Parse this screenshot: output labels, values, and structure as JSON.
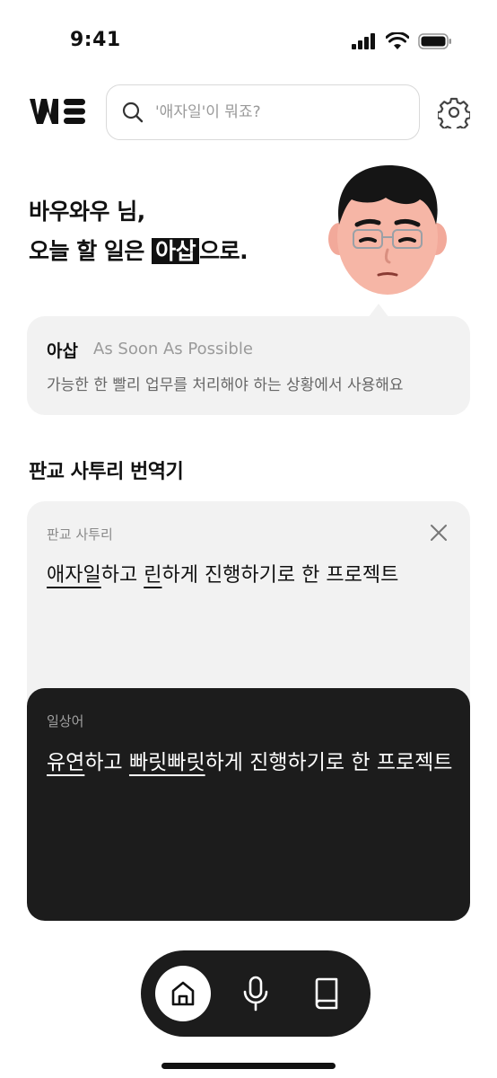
{
  "status_bar": {
    "time": "9:41"
  },
  "search": {
    "placeholder": "'애자일'이 뭐죠?"
  },
  "greeting": {
    "line1": "바우와우 님,",
    "line2_prefix": "오늘 할 일은 ",
    "line2_highlight": "아삽",
    "line2_suffix": "으로."
  },
  "definition": {
    "word": "아삽",
    "full": "As Soon As Possible",
    "description": "가능한 한 빨리 업무를 처리해야 하는 상황에서 사용해요"
  },
  "translator": {
    "title": "판교 사투리 번역기",
    "input_label": "판교 사투리",
    "input_parts": [
      {
        "text": "애자일",
        "underline": true
      },
      {
        "text": "하고 ",
        "underline": false
      },
      {
        "text": "린",
        "underline": true
      },
      {
        "text": "하게 진행하기로 한 프로젝트",
        "underline": false
      }
    ],
    "output_label": "일상어",
    "output_parts": [
      {
        "text": "유연",
        "underline": true
      },
      {
        "text": "하고 ",
        "underline": false
      },
      {
        "text": "빠릿빠릿",
        "underline": true
      },
      {
        "text": "하게 진행하기로 한 프로젝트",
        "underline": false
      }
    ]
  },
  "icons": {
    "search": "search-icon",
    "settings": "gear-icon",
    "close": "close-icon",
    "home": "home-icon",
    "mic": "microphone-icon",
    "book": "book-icon"
  },
  "colors": {
    "dark": "#1c1c1c",
    "card": "#f2f2f2",
    "muted": "#9a9a9a"
  }
}
